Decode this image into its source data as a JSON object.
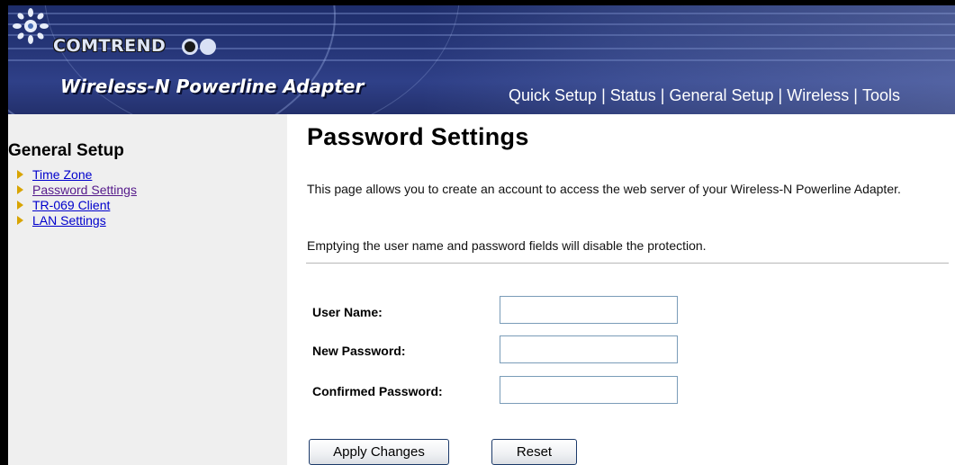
{
  "header": {
    "brand": "COMTREND",
    "product": "Wireless-N Powerline Adapter",
    "nav": [
      "Quick Setup",
      "Status",
      "General Setup",
      "Wireless",
      "Tools"
    ]
  },
  "sidebar": {
    "title": "General Setup",
    "items": [
      {
        "label": "Time Zone"
      },
      {
        "label": "Password Settings"
      },
      {
        "label": "TR-069 Client"
      },
      {
        "label": "LAN Settings"
      }
    ]
  },
  "main": {
    "title": "Password Settings",
    "description": "This page allows you to create an account to access the web server of your Wireless-N Powerline Adapter.",
    "note": "Emptying the user name and password fields will disable the protection.",
    "fields": [
      {
        "label": "User Name:",
        "value": ""
      },
      {
        "label": "New Password:",
        "value": ""
      },
      {
        "label": "Confirmed Password:",
        "value": ""
      }
    ],
    "buttons": {
      "apply": "Apply Changes",
      "reset": "Reset"
    }
  },
  "colors": {
    "banner": "#27377a",
    "sidebar_bg": "#efefef",
    "link": "#0000cc",
    "bullet": "#d8a400"
  }
}
